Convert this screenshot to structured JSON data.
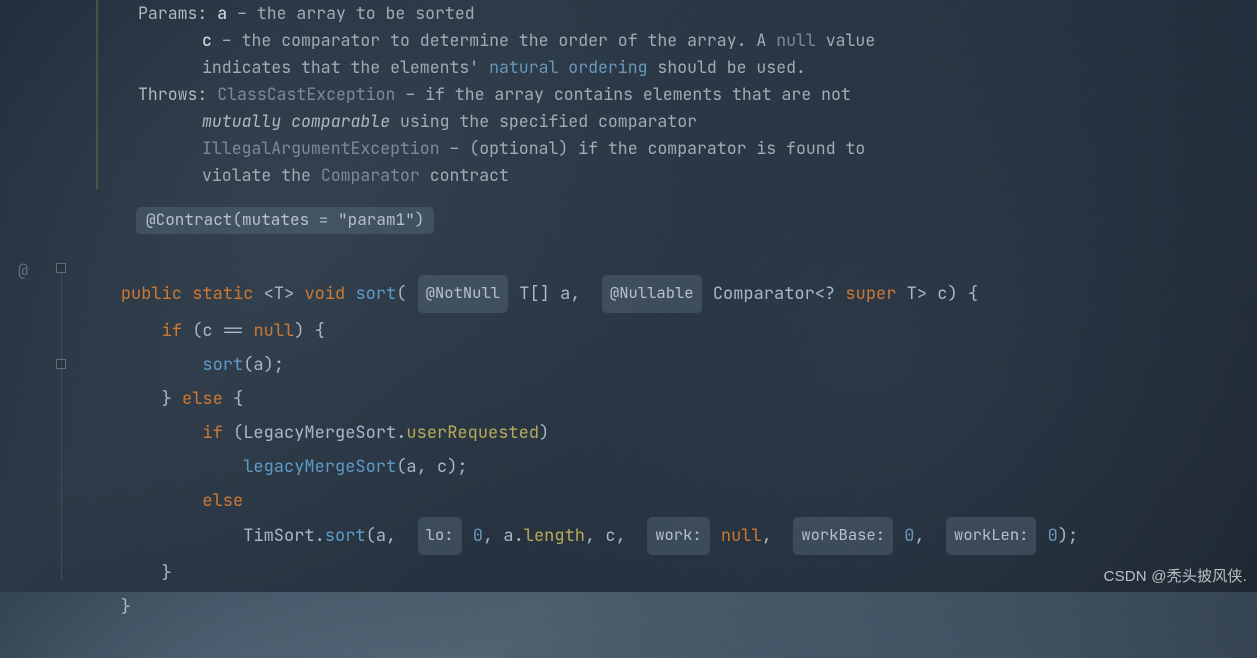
{
  "javadoc": {
    "params_label": "Params:",
    "param_a_name": "a",
    "param_a_desc": " – the array to be sorted",
    "param_c_name": "c",
    "param_c_desc_1": " – the comparator to determine the order of the array. A ",
    "param_c_null": "null",
    "param_c_desc_2": " value",
    "param_c_line2_1": "indicates that the elements' ",
    "param_c_link": "natural ordering",
    "param_c_line2_2": " should be used.",
    "throws_label": "Throws:",
    "throws1_link": "ClassCastException",
    "throws1_desc": " – if the array contains elements that are not",
    "throws1_line2_em": "mutually comparable",
    "throws1_line2_rest": " using the specified comparator",
    "throws2_link": "IllegalArgumentException",
    "throws2_desc": " – (optional) if the comparator is found to",
    "throws2_line2_1": "violate the ",
    "throws2_line2_link": "Comparator",
    "throws2_line2_2": " contract"
  },
  "annotation": {
    "contract": "@Contract(mutates = \"param1\")"
  },
  "code": {
    "kw_public": "public",
    "kw_static": "static",
    "generic": "<T>",
    "kw_void": "void",
    "method_name": "sort",
    "hint_notnull": "@NotNull",
    "p1_type": "T[]",
    "p1_name": "a",
    "hint_nullable": "@Nullable",
    "p2_type_1": "Comparator<?",
    "kw_super": "super",
    "p2_type_2": "T>",
    "p2_name": "c",
    "kw_if": "if",
    "cond1_lhs": "c",
    "cond1_op": "==",
    "kw_null": "null",
    "call_sort": "sort",
    "arg_a": "a",
    "kw_else": "else",
    "cond2_class": "LegacyMergeSort",
    "cond2_field": "userRequested",
    "call_legacy": "legacyMergeSort",
    "arg_c": "c",
    "call_timsort_cls": "TimSort",
    "call_timsort_m": "sort",
    "hint_lo": "lo:",
    "val_0a": "0",
    "arg_alen_1": "a",
    "arg_alen_2": "length",
    "hint_work": "work:",
    "hint_workbase": "workBase:",
    "val_0b": "0",
    "hint_worklen": "workLen:",
    "val_0c": "0"
  },
  "gutter": {
    "at": "@"
  },
  "watermark": "CSDN @秃头披风侠."
}
